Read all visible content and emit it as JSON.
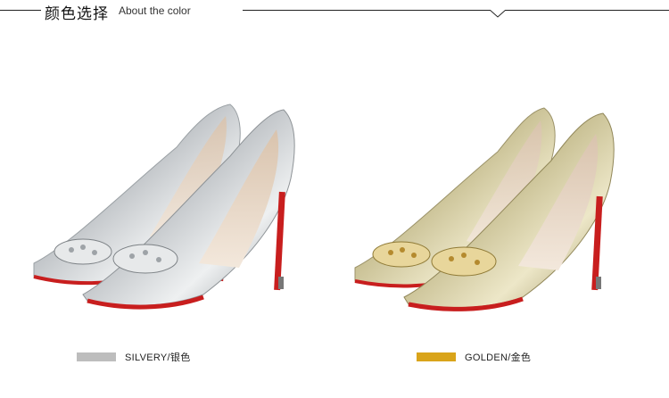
{
  "header": {
    "title_cn": "颜色选择",
    "title_en": "About the color"
  },
  "colors": [
    {
      "label": "SILVERY/银色",
      "swatch": "#bdbdbd",
      "image": "silver-pumps"
    },
    {
      "label": "GOLDEN/金色",
      "swatch": "#d9a41a",
      "image": "gold-pumps"
    }
  ],
  "palette": {
    "sole_red": "#c81e1e",
    "silver": "#d9dcde",
    "gold": "#d6cfae"
  }
}
